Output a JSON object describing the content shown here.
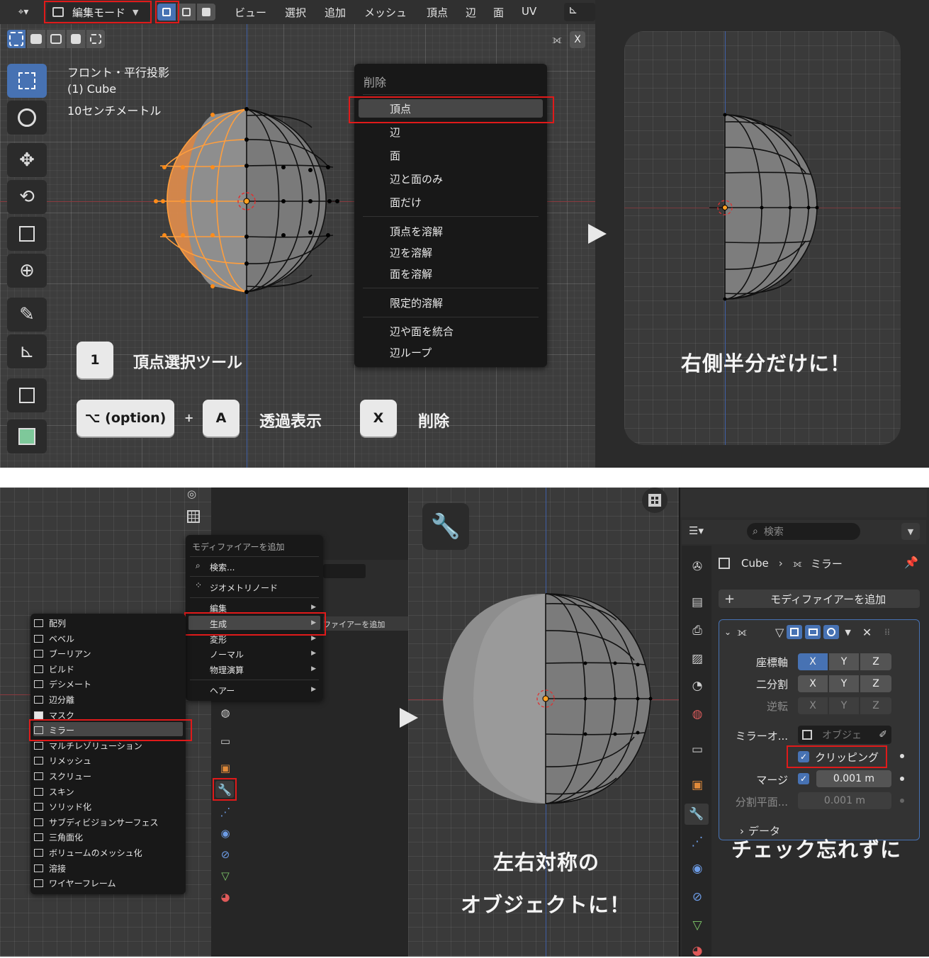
{
  "top_viewport": {
    "header": {
      "mode_label": "編集モード",
      "menus": [
        "ビュー",
        "選択",
        "追加",
        "メッシュ",
        "頂点",
        "辺",
        "面",
        "UV"
      ],
      "x_label": "X"
    },
    "overlay_text": {
      "view_name": "フロント・平行投影",
      "object": "(1) Cube",
      "scale": "10センチメートル"
    },
    "delete_menu": {
      "title": "削除",
      "groups": [
        [
          "頂点",
          "辺",
          "面",
          "辺と面のみ",
          "面だけ"
        ],
        [
          "頂点を溶解",
          "辺を溶解",
          "面を溶解"
        ],
        [
          "限定的溶解"
        ],
        [
          "辺や面を統合",
          "辺ループ"
        ]
      ]
    },
    "hints": [
      {
        "key": "1",
        "text": "頂点選択ツール"
      },
      {
        "key": "⌥ (option)",
        "plus": "+",
        "key2": "A",
        "text": "透過表示"
      },
      {
        "key": "X",
        "text": "削除"
      }
    ]
  },
  "right_panel": {
    "caption": "右側半分だけに！"
  },
  "bottom_left": {
    "add_menu": {
      "title": "モディファイアーを追加",
      "search": "検索...",
      "geometry_nodes": "ジオメトリノード",
      "categories": [
        "編集",
        "生成",
        "変形",
        "ノーマル",
        "物理演算",
        "ヘアー"
      ],
      "ghost_text": "ファイアーを追加"
    },
    "generate_list": [
      "配列",
      "ベベル",
      "ブーリアン",
      "ビルド",
      "デシメート",
      "辺分離",
      "マスク",
      "ミラー",
      "マルチレゾリューション",
      "リメッシュ",
      "スクリュー",
      "スキン",
      "ソリッド化",
      "サブディビジョンサーフェス",
      "三角面化",
      "ボリュームのメッシュ化",
      "溶接",
      "ワイヤーフレーム"
    ]
  },
  "bottom_middle": {
    "caption_line1": "左右対称の",
    "caption_line2": "オブジェクトに！"
  },
  "properties": {
    "search_placeholder": "検索",
    "breadcrumb_object": "Cube",
    "breadcrumb_modifier": "ミラー",
    "add_modifier": "モディファイアーを追加",
    "axis_label": "座標軸",
    "bisect_label": "二分割",
    "flip_label": "逆転",
    "axes": [
      "X",
      "Y",
      "Z"
    ],
    "mirror_object_label": "ミラーオ...",
    "mirror_object_placeholder": "オブジェ",
    "clipping_label": "クリッピング",
    "merge_label": "マージ",
    "merge_value": "0.001 m",
    "bisect_distance_label": "分割平面...",
    "bisect_distance_value": "0.001 m",
    "data_label": "データ",
    "caption": "チェック忘れずに"
  },
  "colors": {
    "highlight_red": "#e01a1a",
    "accent_blue": "#4772b3",
    "selected_orange": "#ff8c1a"
  }
}
